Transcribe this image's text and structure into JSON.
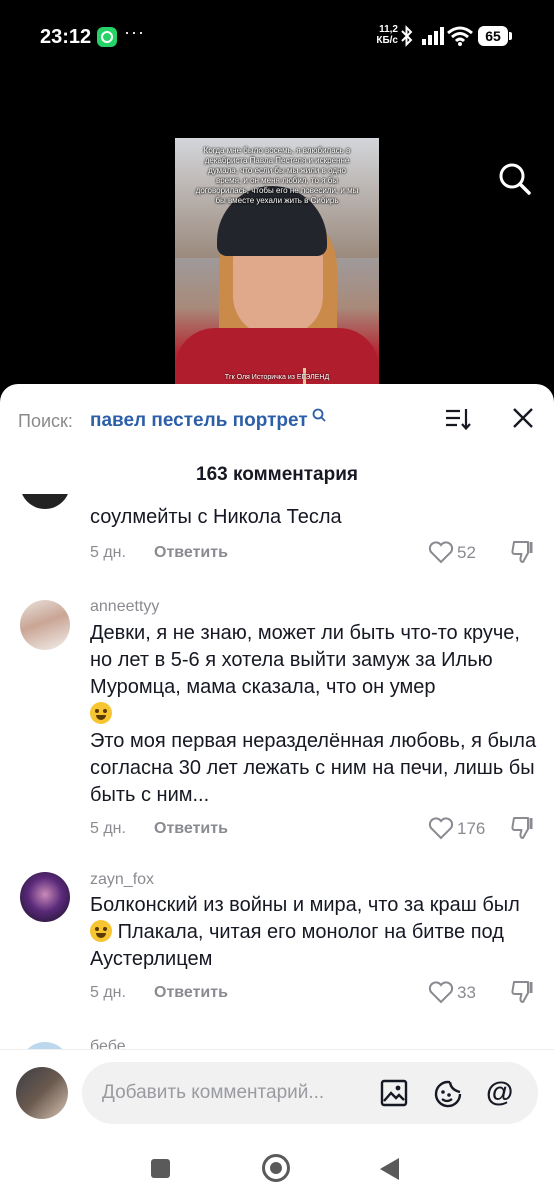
{
  "status_bar": {
    "time": "23:12",
    "dots": "···",
    "net_speed_value": "11,2",
    "net_speed_unit": "КБ/с",
    "battery": "65"
  },
  "video": {
    "caption": "Когда мне было восемь, я влюбилась в декабриста Павла Пестеля и искренне думала, что если бы мы жили в одно время, и он меня любил, то я бы договорилась, чтобы его не повесили, и мы бы вместе уехали жить в Сибирь",
    "watermark": "Тгк Оля Историчка из ЕГЭЛЕНД"
  },
  "search": {
    "label": "Поиск:",
    "query": "павел пестель портрет"
  },
  "comments_count_title": "163 комментария",
  "comments": [
    {
      "username": "",
      "text": "соулмейты с Никола Тесла",
      "time": "5 дн.",
      "reply": "Ответить",
      "likes": "52"
    },
    {
      "username": "anneettyy",
      "text_1": "Девки, я не знаю, может ли быть что-то круче, но лет в 5-6 я хотела выйти замуж за Илью Муромца, мама сказала, что он умер",
      "text_2": "Это моя первая неразделённая любовь, я была согласна 30 лет лежать с ним на печи, лишь бы быть с ним...",
      "emoji": "joy-emoji",
      "time": "5 дн.",
      "reply": "Ответить",
      "likes": "176"
    },
    {
      "username": "zayn_fox",
      "text_1": "Болконский из войны и мира, что за краш был",
      "text_2": "Плакала, читая его монолог на битве под Аустерлицем",
      "emoji": "pleading-emoji",
      "time": "5 дн.",
      "reply": "Ответить",
      "likes": "33"
    },
    {
      "username": "бебе"
    }
  ],
  "input": {
    "placeholder": "Добавить комментарий..."
  },
  "colors": {
    "accent": "#2d5fa8",
    "text": "#161823",
    "muted": "#8a8b91"
  }
}
